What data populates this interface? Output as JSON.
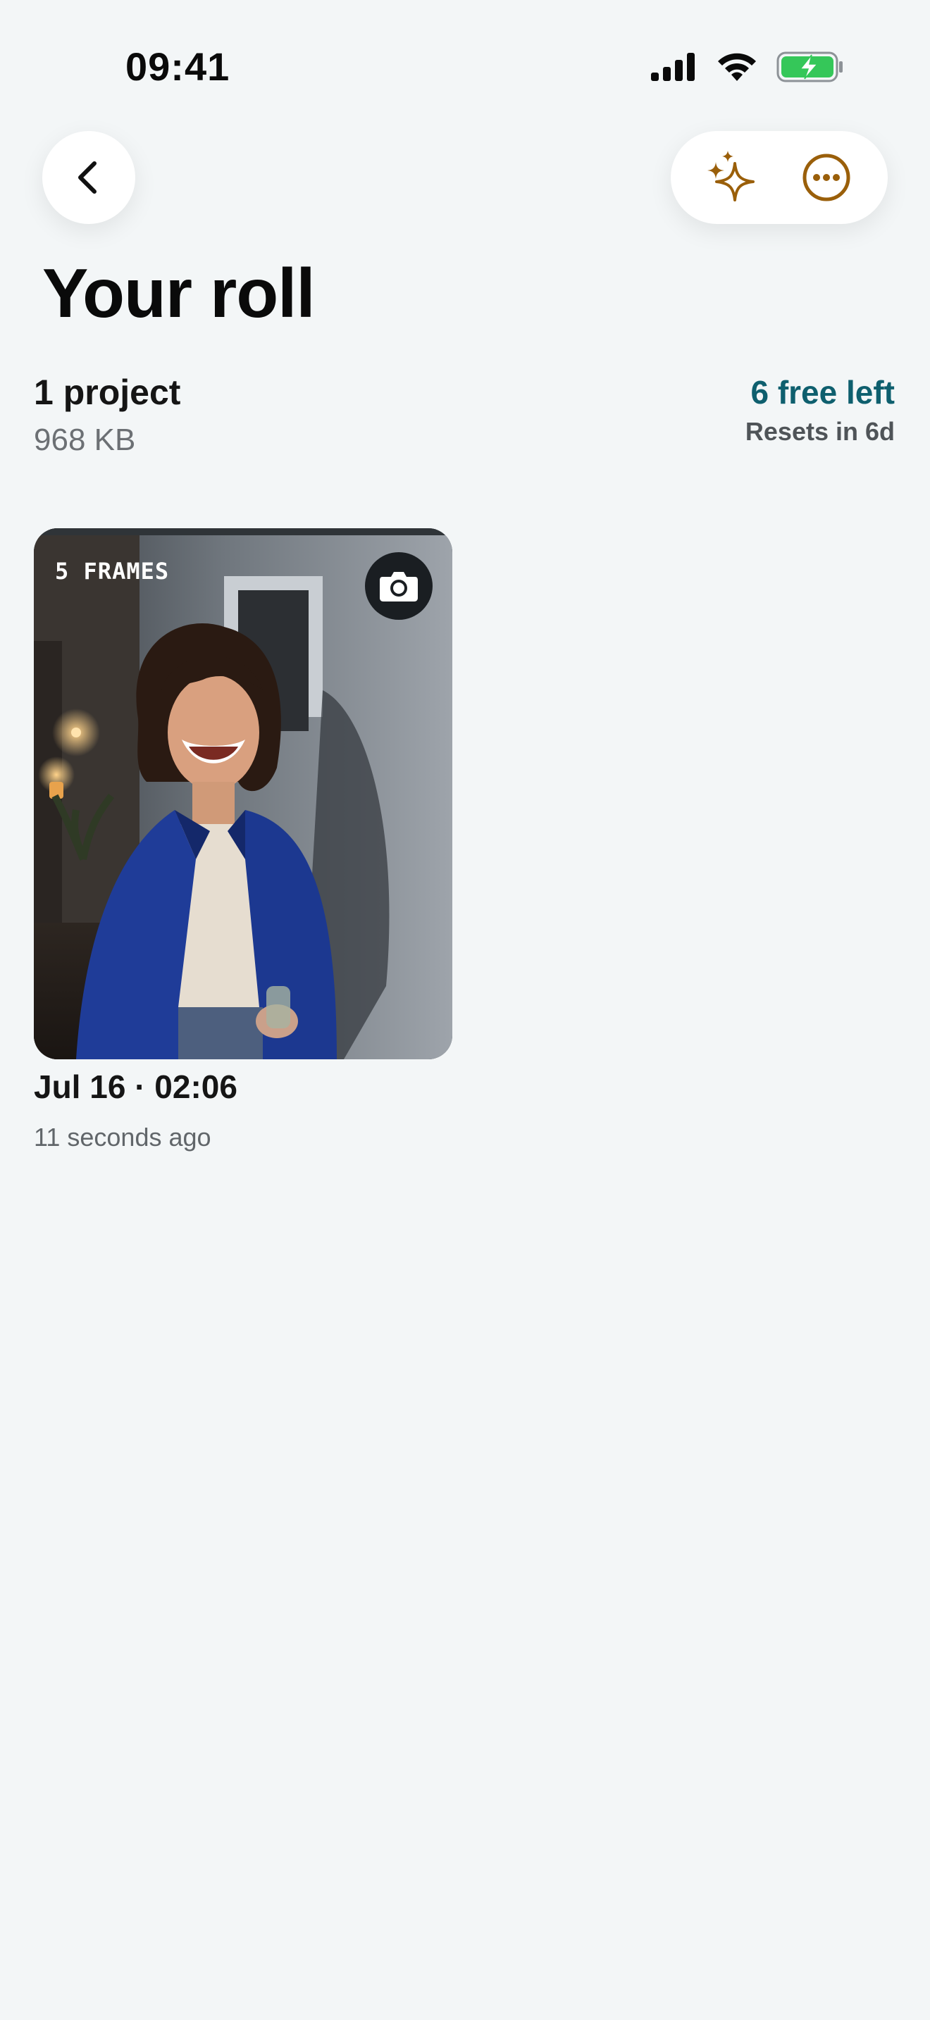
{
  "status_bar": {
    "time": "09:41",
    "icons": [
      "signal-icon",
      "wifi-icon",
      "battery-charging-icon"
    ]
  },
  "nav": {
    "back_icon": "chevron-left-icon",
    "sparkle_icon": "sparkles-icon",
    "more_icon": "ellipsis-circle-icon",
    "accent_color": "#9a5f0a"
  },
  "page": {
    "title": "Your roll"
  },
  "stats": {
    "project_count": "1 project",
    "storage": "968 KB",
    "free_left": "6 free left",
    "resets": "Resets in 6d"
  },
  "projects": [
    {
      "frames": "5 FRAMES",
      "date": "Jul 16 · 02:06",
      "time_ago": "11 seconds ago",
      "badge_icon": "camera-icon"
    }
  ]
}
